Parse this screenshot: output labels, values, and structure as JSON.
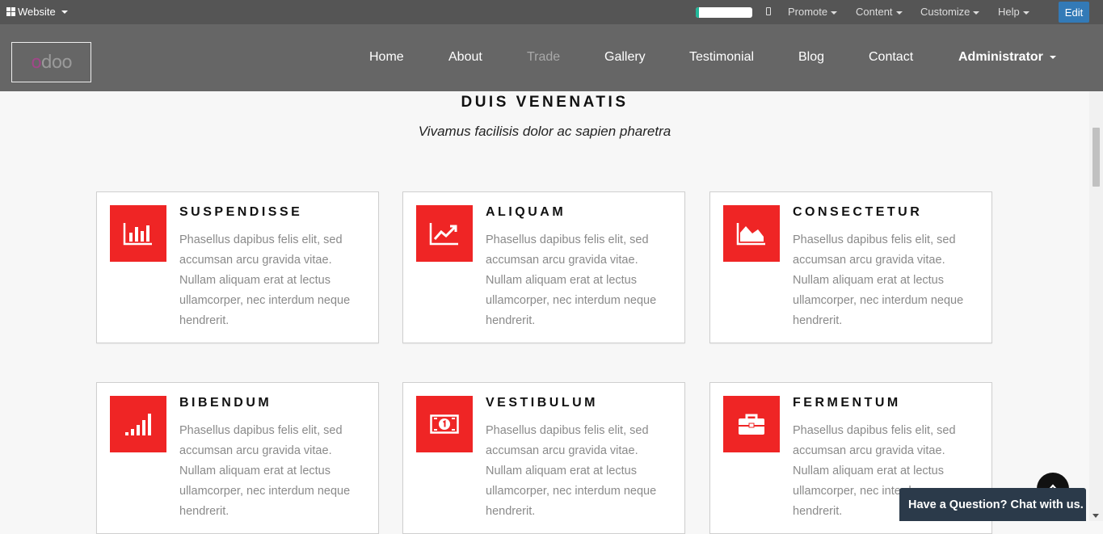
{
  "admin_bar": {
    "website_menu": "Website",
    "progress_fraction": 0.05,
    "menus": [
      "Promote",
      "Content",
      "Customize",
      "Help"
    ],
    "edit_button": "Edit"
  },
  "navbar": {
    "logo_text": "odoo",
    "items": [
      "Home",
      "About",
      "Trade",
      "Gallery",
      "Testimonial",
      "Blog",
      "Contact"
    ],
    "active_item": "Trade",
    "user_menu": "Administrator"
  },
  "section": {
    "title": "DUIS VENENATIS",
    "subtitle": "Vivamus facilisis dolor ac sapien pharetra"
  },
  "cards": [
    {
      "title": "SUSPENDISSE",
      "icon": "bar-chart-icon",
      "text": "Phasellus dapibus felis elit, sed accumsan arcu gravida vitae. Nullam aliquam erat at lectus ullamcorper, nec interdum neque hendrerit."
    },
    {
      "title": "ALIQUAM",
      "icon": "line-chart-icon",
      "text": "Phasellus dapibus felis elit, sed accumsan arcu gravida vitae. Nullam aliquam erat at lectus ullamcorper, nec interdum neque hendrerit."
    },
    {
      "title": "CONSECTETUR",
      "icon": "area-chart-icon",
      "text": "Phasellus dapibus felis elit, sed accumsan arcu gravida vitae. Nullam aliquam erat at lectus ullamcorper, nec interdum neque hendrerit."
    },
    {
      "title": "BIBENDUM",
      "icon": "signal-icon",
      "text": "Phasellus dapibus felis elit, sed accumsan arcu gravida vitae. Nullam aliquam erat at lectus ullamcorper, nec interdum neque hendrerit."
    },
    {
      "title": "VESTIBULUM",
      "icon": "money-icon",
      "text": "Phasellus dapibus felis elit, sed accumsan arcu gravida vitae. Nullam aliquam erat at lectus ullamcorper, nec interdum neque hendrerit."
    },
    {
      "title": "FERMENTUM",
      "icon": "briefcase-icon",
      "text": "Phasellus dapibus felis elit, sed accumsan arcu gravida vitae. Nullam aliquam erat at lectus ullamcorper, nec interdum neque hendrerit."
    }
  ],
  "chat": {
    "label": "Have a Question? Chat with us."
  },
  "colors": {
    "admin_bar": "#555555",
    "navbar": "#666666",
    "accent_red": "#ef2525",
    "edit_blue": "#337ab7",
    "chat_bg": "#2b3a4a",
    "progress_green": "#21b799"
  }
}
